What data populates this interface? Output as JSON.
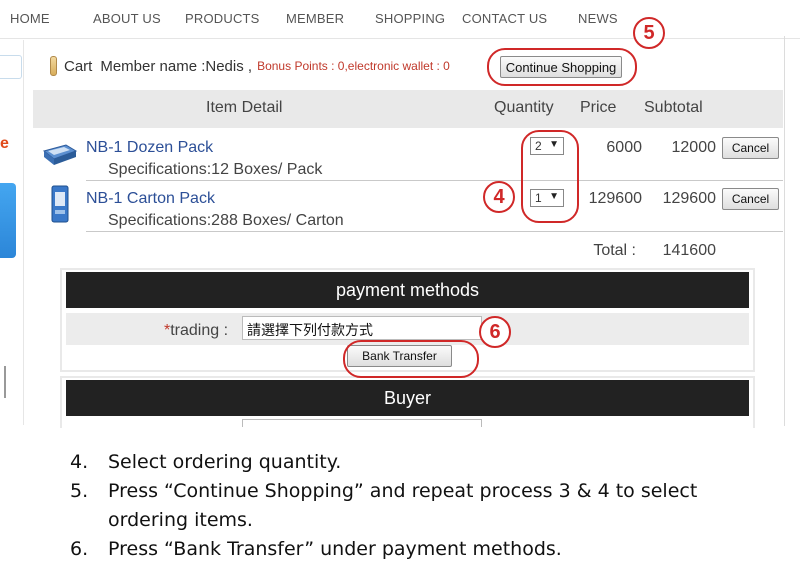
{
  "nav": {
    "items": [
      "HOME",
      "ABOUT US",
      "PRODUCTS",
      "MEMBER",
      "SHOPPING",
      "CONTACT US",
      "NEWS"
    ]
  },
  "cart": {
    "label": "Cart",
    "member": "Member name :Nedis ,",
    "points": "Bonus Points : 0,electronic wallet : 0",
    "continue_button": "Continue Shopping"
  },
  "table": {
    "headers": {
      "item_detail": "Item Detail",
      "quantity": "Quantity",
      "price": "Price",
      "subtotal": "Subtotal"
    },
    "rows": [
      {
        "name": "NB-1 Dozen Pack",
        "spec": "Specifications:12 Boxes/ Pack",
        "qty": "2",
        "price": "6000",
        "subtotal": "12000",
        "cancel": "Cancel"
      },
      {
        "name": "NB-1 Carton Pack",
        "spec": "Specifications:288 Boxes/ Carton",
        "qty": "1",
        "price": "129600",
        "subtotal": "129600",
        "cancel": "Cancel"
      }
    ],
    "total_label": "Total :",
    "total_value": "141600"
  },
  "payment": {
    "title": "payment  methods",
    "required_mark": "*",
    "trading_label": "trading :",
    "trading_value": "請選擇下列付款方式",
    "bank_button": "Bank Transfer"
  },
  "buyer": {
    "title": "Buyer"
  },
  "annotations": {
    "n4": "4",
    "n5": "5",
    "n6": "6",
    "color": "#d02828"
  },
  "instructions": [
    {
      "n": "4.",
      "text": "Select ordering quantity."
    },
    {
      "n": "5.",
      "text": "Press “Continue Shopping” and repeat process 3 & 4 to select ordering items."
    },
    {
      "n": "6.",
      "text": "Press “Bank Transfer” under payment methods."
    }
  ],
  "colors": {
    "header_band": "#e9e9e9",
    "panel_head": "#222222",
    "link": "#2c4f97",
    "points": "#c0392b"
  }
}
